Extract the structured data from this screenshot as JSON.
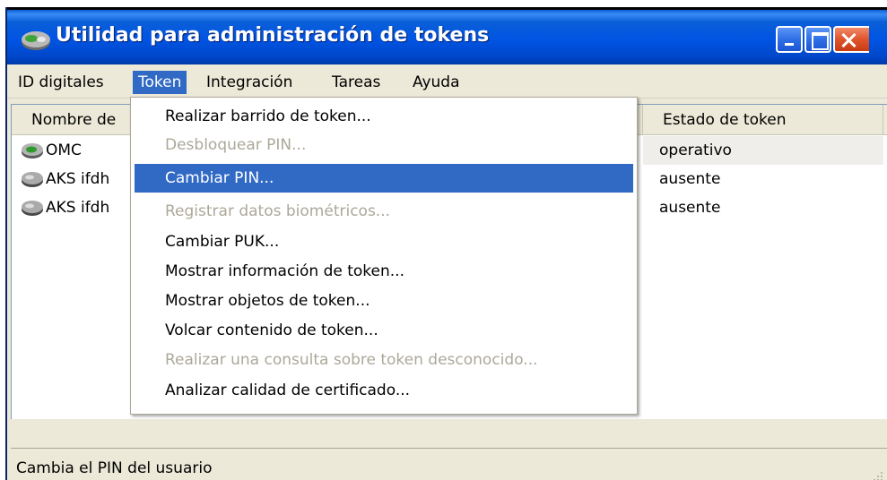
{
  "window": {
    "title": "Utilidad para administración de tokens",
    "icon": "token-key-icon",
    "controls": [
      "minimize-icon",
      "maximize-icon",
      "close-icon"
    ]
  },
  "menubar": {
    "items": [
      "ID digitales",
      "Token",
      "Integración",
      "Tareas",
      "Ayuda"
    ],
    "active": "Token"
  },
  "list": {
    "columns": [
      "Nombre de",
      "Estado de token"
    ],
    "rows": [
      {
        "name": "OMC",
        "status": "operativo",
        "icon": "token-green-icon"
      },
      {
        "name": "AKS ifdh",
        "status": "ausente",
        "icon": "token-gray-icon"
      },
      {
        "name": "AKS ifdh",
        "status": "ausente",
        "icon": "token-gray-icon"
      }
    ]
  },
  "dropdown": {
    "items": [
      {
        "label": "Realizar barrido de token...",
        "state": "enabled"
      },
      {
        "label": "Desbloquear PIN...",
        "state": "disabled"
      },
      {
        "label": "Cambiar PIN...",
        "state": "selected"
      },
      {
        "label": "Registrar datos biométricos...",
        "state": "disabled"
      },
      {
        "label": "Cambiar PUK...",
        "state": "enabled"
      },
      {
        "label": "Mostrar información de token...",
        "state": "enabled"
      },
      {
        "label": "Mostrar objetos de token...",
        "state": "enabled"
      },
      {
        "label": "Volcar contenido de token...",
        "state": "enabled"
      },
      {
        "label": "Realizar una consulta sobre token desconocido...",
        "state": "disabled"
      },
      {
        "label": "Analizar calidad de certificado...",
        "state": "enabled"
      }
    ]
  },
  "statusbar": {
    "text": "Cambia el PIN del usuario"
  },
  "colors": {
    "titlebar": "#0054e3",
    "selection": "#316ac5",
    "disabled_text": "#aca899",
    "chrome": "#ece9d8"
  }
}
